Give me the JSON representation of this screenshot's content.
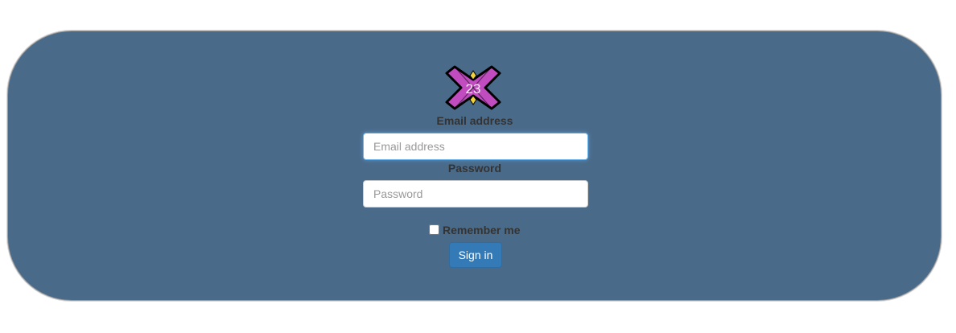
{
  "logo": {
    "text": "23",
    "icon": "x-star-logo-icon",
    "colors": {
      "fill": "#c04cc0",
      "accent": "#f0d23c",
      "outline": "#000000"
    }
  },
  "form": {
    "email_label": "Email address",
    "email_placeholder": "Email address",
    "email_value": "",
    "password_label": "Password",
    "password_placeholder": "Password",
    "password_value": "",
    "remember_label": "Remember me",
    "remember_checked": false,
    "submit_label": "Sign in"
  },
  "colors": {
    "panel": "#4a6a89",
    "button": "#337ab7",
    "label": "#333333"
  }
}
